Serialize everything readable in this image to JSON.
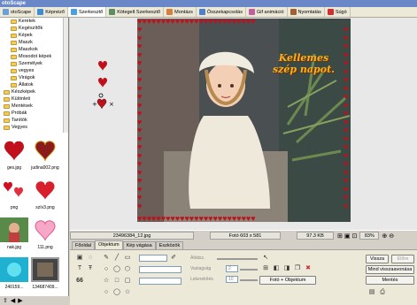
{
  "window": {
    "title": "otoScape"
  },
  "menu": [
    {
      "label": "otoScape",
      "color": "#6aa0d8"
    },
    {
      "label": "Képnéző",
      "color": "#3a8ed8"
    },
    {
      "label": "Szerkesztő",
      "color": "#4aa0e0",
      "active": true
    },
    {
      "label": "Kötegelt Szerkesztő",
      "color": "#5a9060"
    },
    {
      "label": "Montázs",
      "color": "#d8803a"
    },
    {
      "label": "Összekapcsolás",
      "color": "#5080c8"
    },
    {
      "label": "Gif animáció",
      "color": "#c060a0"
    },
    {
      "label": "Nyomtatás",
      "color": "#a06030"
    },
    {
      "label": "Súgó",
      "color": "#d03030"
    }
  ],
  "tree": {
    "items": [
      "Keretek",
      "Kegészítők",
      "Képek",
      "Maszk",
      "Maszkok",
      "Mosodot képek",
      "Személyek",
      "vegyes",
      "Virágok",
      "Állatok",
      "Készképek",
      "Különleti",
      "Mentések",
      "Próbák",
      "Tanítók",
      "Vegyes"
    ]
  },
  "thumbnails": [
    {
      "caption": "ges.jpg",
      "kind": "heart-red"
    },
    {
      "caption": "judina002.png",
      "kind": "heart-gold"
    },
    {
      "caption": "png",
      "kind": "hearts-small"
    },
    {
      "caption": "szív3.png",
      "kind": "heart-red2"
    },
    {
      "caption": "nak.jpg",
      "kind": "photo-green"
    },
    {
      "caption": "111.png",
      "kind": "heart-pink"
    },
    {
      "caption": "240159...",
      "kind": "photo-cyan"
    },
    {
      "caption": "134687409...",
      "kind": "photo-frame"
    }
  ],
  "canvas": {
    "greeting_line1": "Kellemes",
    "greeting_line2": "szép napot."
  },
  "info_bar": {
    "filename": "23496384_12.jpg",
    "photo_size": "Fotó 603 x 581",
    "file_size": "97.3 KB",
    "zoom": "83%"
  },
  "tabs": [
    {
      "label": "Főoldal",
      "active": false
    },
    {
      "label": "Objektum",
      "active": true
    },
    {
      "label": "Kép vágása",
      "active": false
    },
    {
      "label": "Eszközök",
      "active": false
    }
  ],
  "tools": {
    "quote_sign": "66",
    "opacity_label": "Átlátsz.",
    "line_width_label": "Vastagság",
    "line_width_value": "2",
    "corner_label": "Lekerekítés",
    "corner_value": "10",
    "photo_object_button": "Fotó + Objektum"
  },
  "buttons": {
    "back": "Vissza",
    "forward": "Előre",
    "restore_all": "Mind visszaavonása",
    "save": "Mentés"
  }
}
